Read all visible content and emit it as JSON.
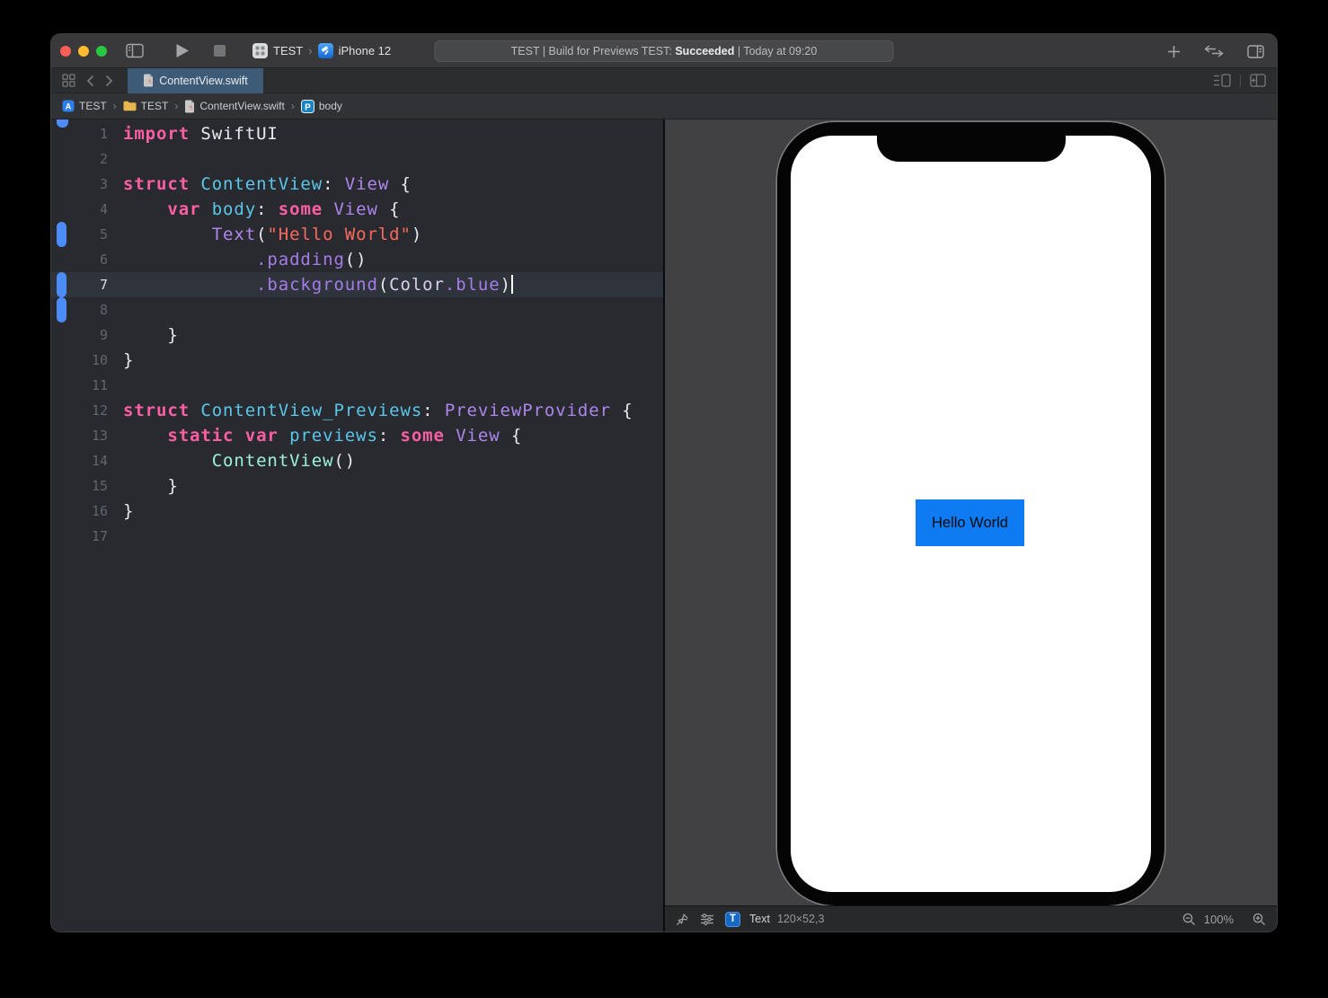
{
  "colors": {
    "kw": "#FC5FA3",
    "decl": "#58C7E9",
    "type": "#AE85EC",
    "fn": "#A67CE8",
    "str": "#FC6A5D",
    "mint": "#9EF1DD",
    "plain": "#E9EAEC",
    "colortype": "#D8D0EE",
    "swiftui_blue": "#0E7BF3",
    "change_bar": "#4C8CF8",
    "tab_active": "#3D5A77"
  },
  "toolbar": {
    "scheme_target": "TEST",
    "scheme_destination": "iPhone 12",
    "status_pre": "TEST | Build for Previews TEST: ",
    "status_bold": "Succeeded",
    "status_post": " | Today at 09:20"
  },
  "tabbar": {
    "tab_label": "ContentView.swift"
  },
  "jumpbar": {
    "items": [
      "TEST",
      "TEST",
      "ContentView.swift",
      "body"
    ]
  },
  "editor": {
    "lines": [
      {
        "n": 1,
        "s": [
          [
            "import ",
            "kw"
          ],
          [
            "SwiftUI",
            "pl"
          ]
        ]
      },
      {
        "n": 2,
        "s": []
      },
      {
        "n": 3,
        "s": [
          [
            "struct ",
            "kw"
          ],
          [
            "ContentView",
            "decl"
          ],
          [
            ": ",
            "pl"
          ],
          [
            "View",
            "type"
          ],
          [
            " {",
            "pl"
          ]
        ]
      },
      {
        "n": 4,
        "s": [
          [
            "    ",
            "pl"
          ],
          [
            "var ",
            "kw"
          ],
          [
            "body",
            "decl"
          ],
          [
            ": ",
            "pl"
          ],
          [
            "some ",
            "kw"
          ],
          [
            "View",
            "type"
          ],
          [
            " {",
            "pl"
          ]
        ]
      },
      {
        "n": 5,
        "changed": true,
        "s": [
          [
            "        ",
            "pl"
          ],
          [
            "Text",
            "type"
          ],
          [
            "(",
            "pl"
          ],
          [
            "\"Hello World\"",
            "str"
          ],
          [
            ")",
            "pl"
          ]
        ]
      },
      {
        "n": 6,
        "s": [
          [
            "            ",
            "pl"
          ],
          [
            ".padding",
            "fn"
          ],
          [
            "()",
            "pl"
          ]
        ]
      },
      {
        "n": 7,
        "changed": true,
        "current": true,
        "cursor": true,
        "s": [
          [
            "            ",
            "pl"
          ],
          [
            ".background",
            "fn"
          ],
          [
            "(",
            "pl"
          ],
          [
            "Color",
            "colortype"
          ],
          [
            ".blue",
            "fn"
          ],
          [
            ")",
            "pl"
          ]
        ]
      },
      {
        "n": 8,
        "changed": true,
        "s": []
      },
      {
        "n": 9,
        "s": [
          [
            "    }",
            "pl"
          ]
        ]
      },
      {
        "n": 10,
        "s": [
          [
            "}",
            "pl"
          ]
        ]
      },
      {
        "n": 11,
        "s": []
      },
      {
        "n": 12,
        "s": [
          [
            "struct ",
            "kw"
          ],
          [
            "ContentView_Previews",
            "decl"
          ],
          [
            ": ",
            "pl"
          ],
          [
            "PreviewProvider",
            "type"
          ],
          [
            " {",
            "pl"
          ]
        ]
      },
      {
        "n": 13,
        "s": [
          [
            "    ",
            "pl"
          ],
          [
            "static var ",
            "kw"
          ],
          [
            "previews",
            "decl"
          ],
          [
            ": ",
            "pl"
          ],
          [
            "some ",
            "kw"
          ],
          [
            "View",
            "type"
          ],
          [
            " {",
            "pl"
          ]
        ]
      },
      {
        "n": 14,
        "s": [
          [
            "        ",
            "pl"
          ],
          [
            "ContentView",
            "mint"
          ],
          [
            "()",
            "pl"
          ]
        ]
      },
      {
        "n": 15,
        "s": [
          [
            "    }",
            "pl"
          ]
        ]
      },
      {
        "n": 16,
        "s": [
          [
            "}",
            "pl"
          ]
        ]
      },
      {
        "n": 17,
        "s": []
      }
    ]
  },
  "preview": {
    "hello_label": "Hello World",
    "bar": {
      "selection_type": "Text",
      "selection_size": "120×52,3",
      "zoom_level": "100%"
    }
  }
}
